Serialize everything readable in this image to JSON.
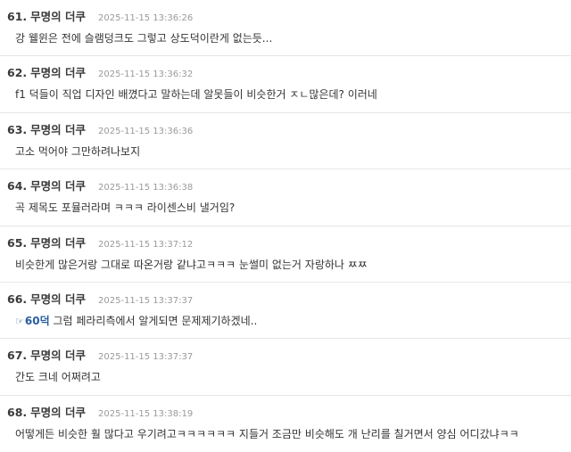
{
  "comments": [
    {
      "number": "61.",
      "author": "무명의 더쿠",
      "time": "2025-11-15 13:36:26",
      "text": "강 웰윈은 전에 슬램덩크도 그렇고 상도덕이란게 없는듯..."
    },
    {
      "number": "62.",
      "author": "무명의 더쿠",
      "time": "2025-11-15 13:36:32",
      "text": "f1 덕들이 직업 디자인 배꼈다고 말하는데 알못들이 비슷한거 ㅈㄴ많은데? 이러네"
    },
    {
      "number": "63.",
      "author": "무명의 더쿠",
      "time": "2025-11-15 13:36:36",
      "text": "고소 먹어야 그만하려나보지"
    },
    {
      "number": "64.",
      "author": "무명의 더쿠",
      "time": "2025-11-15 13:36:38",
      "text": "곡 제목도 포뮬러라며 ㅋㅋㅋ 라이센스비 낼거임?"
    },
    {
      "number": "65.",
      "author": "무명의 더쿠",
      "time": "2025-11-15 13:37:12",
      "text": "비슷한게 많은거랑 그대로 따온거랑 같냐고ㅋㅋㅋ 눈썰미 없는거 자랑하나 ㅉㅉ"
    },
    {
      "number": "66.",
      "author": "무명의 더쿠",
      "time": "2025-11-15 13:37:37",
      "ref_icon": "☞",
      "ref": "60덕",
      "text": " 그럼 페라리측에서 알게되면 문제제기하겠네.."
    },
    {
      "number": "67.",
      "author": "무명의 더쿠",
      "time": "2025-11-15 13:37:37",
      "text": "간도 크네 어쩌려고"
    },
    {
      "number": "68.",
      "author": "무명의 더쿠",
      "time": "2025-11-15 13:38:19",
      "text": "어떻게든 비슷한 훨 많다고 우기려고ㅋㅋㅋㅋㅋㅋ 지들거 조금만 비슷해도 개 난리를 칠거면서 양심 어디갔냐ㅋㅋ"
    }
  ]
}
